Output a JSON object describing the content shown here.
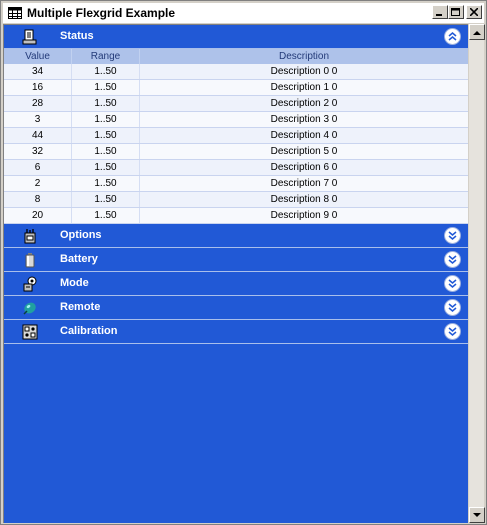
{
  "window": {
    "title": "Multiple Flexgrid Example"
  },
  "sections": [
    {
      "label": "Status",
      "icon": "status-icon",
      "expanded": true
    },
    {
      "label": "Options",
      "icon": "options-icon",
      "expanded": false
    },
    {
      "label": "Battery",
      "icon": "battery-icon",
      "expanded": false
    },
    {
      "label": "Mode",
      "icon": "mode-icon",
      "expanded": false
    },
    {
      "label": "Remote",
      "icon": "remote-icon",
      "expanded": false
    },
    {
      "label": "Calibration",
      "icon": "calibration-icon",
      "expanded": false
    }
  ],
  "grid": {
    "headers": {
      "value": "Value",
      "range": "Range",
      "description": "Description"
    },
    "rows": [
      {
        "value": "34",
        "range": "1..50",
        "description": "Description 0 0"
      },
      {
        "value": "16",
        "range": "1..50",
        "description": "Description 1 0"
      },
      {
        "value": "28",
        "range": "1..50",
        "description": "Description 2 0"
      },
      {
        "value": "3",
        "range": "1..50",
        "description": "Description 3 0"
      },
      {
        "value": "44",
        "range": "1..50",
        "description": "Description 4 0"
      },
      {
        "value": "32",
        "range": "1..50",
        "description": "Description 5 0"
      },
      {
        "value": "6",
        "range": "1..50",
        "description": "Description 6 0"
      },
      {
        "value": "2",
        "range": "1..50",
        "description": "Description 7 0"
      },
      {
        "value": "8",
        "range": "1..50",
        "description": "Description 8 0"
      },
      {
        "value": "20",
        "range": "1..50",
        "description": "Description 9 0"
      }
    ]
  },
  "colors": {
    "panel_blue": "#2159d6",
    "grid_header": "#aec2ea",
    "grid_bg": "#eef2fb"
  }
}
